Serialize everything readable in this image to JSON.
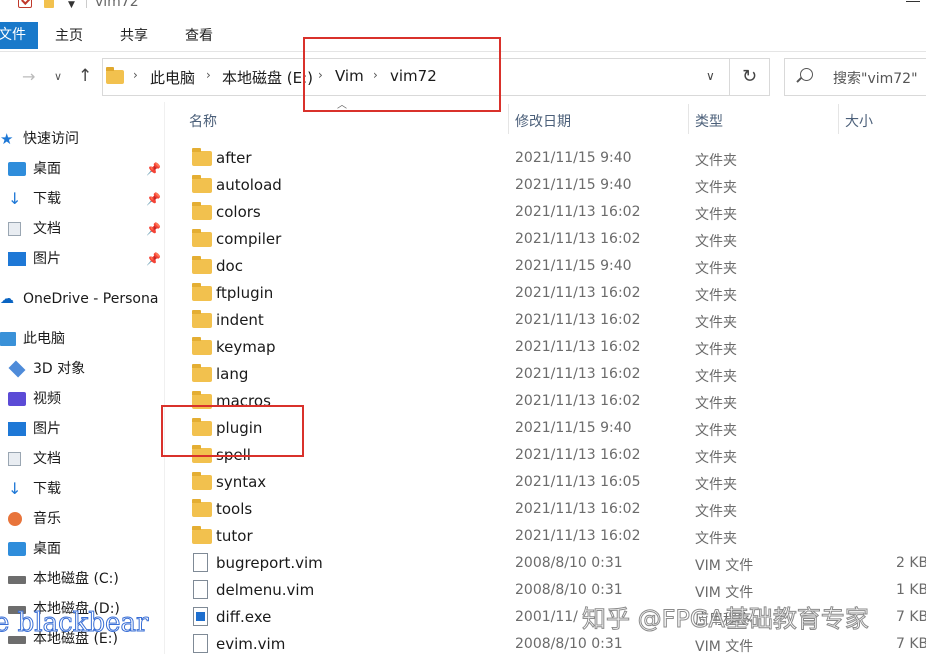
{
  "window": {
    "title": "vim72"
  },
  "ribbon": {
    "tabs": [
      "文件",
      "主页",
      "共享",
      "查看"
    ]
  },
  "address": {
    "crumbs": [
      "此电脑",
      "本地磁盘 (E:)",
      "Vim",
      "vim72"
    ],
    "search_placeholder": "搜索\"vim72\""
  },
  "nav": [
    {
      "label": "快速访问",
      "icon": "star-icon",
      "pinned": false
    },
    {
      "label": "桌面",
      "icon": "desktop-icon",
      "pinned": true
    },
    {
      "label": "下载",
      "icon": "download-icon",
      "pinned": true
    },
    {
      "label": "文档",
      "icon": "document-icon",
      "pinned": true
    },
    {
      "label": "图片",
      "icon": "pictures-icon",
      "pinned": true
    },
    {
      "label": "OneDrive - Persona",
      "icon": "cloud-icon",
      "pinned": false
    },
    {
      "label": "此电脑",
      "icon": "computer-icon",
      "pinned": false
    },
    {
      "label": "3D 对象",
      "icon": "3d-objects-icon",
      "pinned": false
    },
    {
      "label": "视频",
      "icon": "video-icon",
      "pinned": false
    },
    {
      "label": "图片",
      "icon": "pictures-icon",
      "pinned": false
    },
    {
      "label": "文档",
      "icon": "document-icon",
      "pinned": false
    },
    {
      "label": "下载",
      "icon": "download-icon",
      "pinned": false
    },
    {
      "label": "音乐",
      "icon": "music-icon",
      "pinned": false
    },
    {
      "label": "桌面",
      "icon": "desktop-icon",
      "pinned": false
    },
    {
      "label": "本地磁盘 (C:)",
      "icon": "drive-icon",
      "pinned": false
    },
    {
      "label": "本地磁盘 (D:)",
      "icon": "drive-icon",
      "pinned": false
    },
    {
      "label": "本地磁盘 (E:)",
      "icon": "drive-icon",
      "pinned": false
    }
  ],
  "columns": {
    "name": "名称",
    "date": "修改日期",
    "type": "类型",
    "size": "大小"
  },
  "files": [
    {
      "name": "after",
      "date": "2021/11/15 9:40",
      "type": "文件夹",
      "size": "",
      "kind": "folder"
    },
    {
      "name": "autoload",
      "date": "2021/11/15 9:40",
      "type": "文件夹",
      "size": "",
      "kind": "folder"
    },
    {
      "name": "colors",
      "date": "2021/11/13 16:02",
      "type": "文件夹",
      "size": "",
      "kind": "folder"
    },
    {
      "name": "compiler",
      "date": "2021/11/13 16:02",
      "type": "文件夹",
      "size": "",
      "kind": "folder"
    },
    {
      "name": "doc",
      "date": "2021/11/15 9:40",
      "type": "文件夹",
      "size": "",
      "kind": "folder"
    },
    {
      "name": "ftplugin",
      "date": "2021/11/13 16:02",
      "type": "文件夹",
      "size": "",
      "kind": "folder"
    },
    {
      "name": "indent",
      "date": "2021/11/13 16:02",
      "type": "文件夹",
      "size": "",
      "kind": "folder"
    },
    {
      "name": "keymap",
      "date": "2021/11/13 16:02",
      "type": "文件夹",
      "size": "",
      "kind": "folder"
    },
    {
      "name": "lang",
      "date": "2021/11/13 16:02",
      "type": "文件夹",
      "size": "",
      "kind": "folder"
    },
    {
      "name": "macros",
      "date": "2021/11/13 16:02",
      "type": "文件夹",
      "size": "",
      "kind": "folder"
    },
    {
      "name": "plugin",
      "date": "2021/11/15 9:40",
      "type": "文件夹",
      "size": "",
      "kind": "folder"
    },
    {
      "name": "spell",
      "date": "2021/11/13 16:02",
      "type": "文件夹",
      "size": "",
      "kind": "folder"
    },
    {
      "name": "syntax",
      "date": "2021/11/13 16:05",
      "type": "文件夹",
      "size": "",
      "kind": "folder"
    },
    {
      "name": "tools",
      "date": "2021/11/13 16:02",
      "type": "文件夹",
      "size": "",
      "kind": "folder"
    },
    {
      "name": "tutor",
      "date": "2021/11/13 16:02",
      "type": "文件夹",
      "size": "",
      "kind": "folder"
    },
    {
      "name": "bugreport.vim",
      "date": "2008/8/10 0:31",
      "type": "VIM 文件",
      "size": "2 KB",
      "kind": "file"
    },
    {
      "name": "delmenu.vim",
      "date": "2008/8/10 0:31",
      "type": "VIM 文件",
      "size": "1 KB",
      "kind": "file"
    },
    {
      "name": "diff.exe",
      "date": "2001/11/",
      "type": "应用程序",
      "size": "7 KB",
      "kind": "exe"
    },
    {
      "name": "evim.vim",
      "date": "2008/8/10 0:31",
      "type": "VIM 文件",
      "size": "7 KB",
      "kind": "file"
    }
  ],
  "watermarks": {
    "left": "e blackbear",
    "right": "知乎 @FPGA基础教育专家"
  }
}
